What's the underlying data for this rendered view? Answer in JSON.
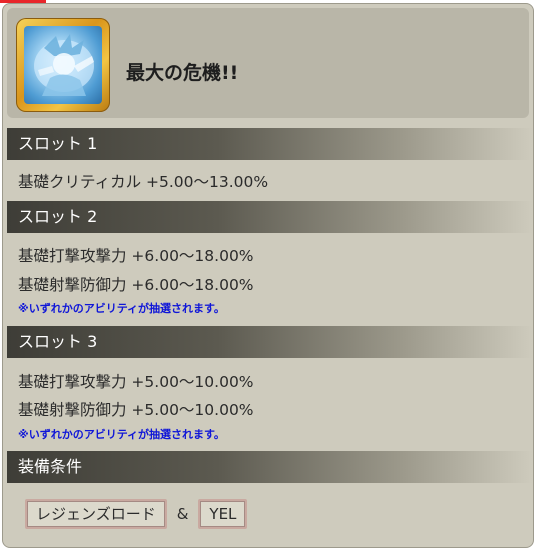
{
  "card": {
    "title": "最大の危機!!",
    "icon": "character-portrait-icon"
  },
  "slots": [
    {
      "label": "スロット 1",
      "abilities": [
        "基礎クリティカル +5.00〜13.00%"
      ],
      "note": ""
    },
    {
      "label": "スロット 2",
      "abilities": [
        "基礎打撃攻撃力 +6.00〜18.00%",
        "基礎射撃防御力 +6.00〜18.00%"
      ],
      "note": "※いずれかのアビリティが抽選されます。"
    },
    {
      "label": "スロット 3",
      "abilities": [
        "基礎打撃攻撃力 +5.00〜10.00%",
        "基礎射撃防御力 +5.00〜10.00%"
      ],
      "note": "※いずれかのアビリティが抽選されます。"
    }
  ],
  "equip": {
    "label": "装備条件",
    "tags": [
      "レジェンズロード",
      "YEL"
    ],
    "joiner": "&"
  },
  "colors": {
    "note": "#0f16d8",
    "bar_dark": "#3e3d37",
    "card_bg": "#cecbbd",
    "frame_gold": "#d9951b"
  }
}
